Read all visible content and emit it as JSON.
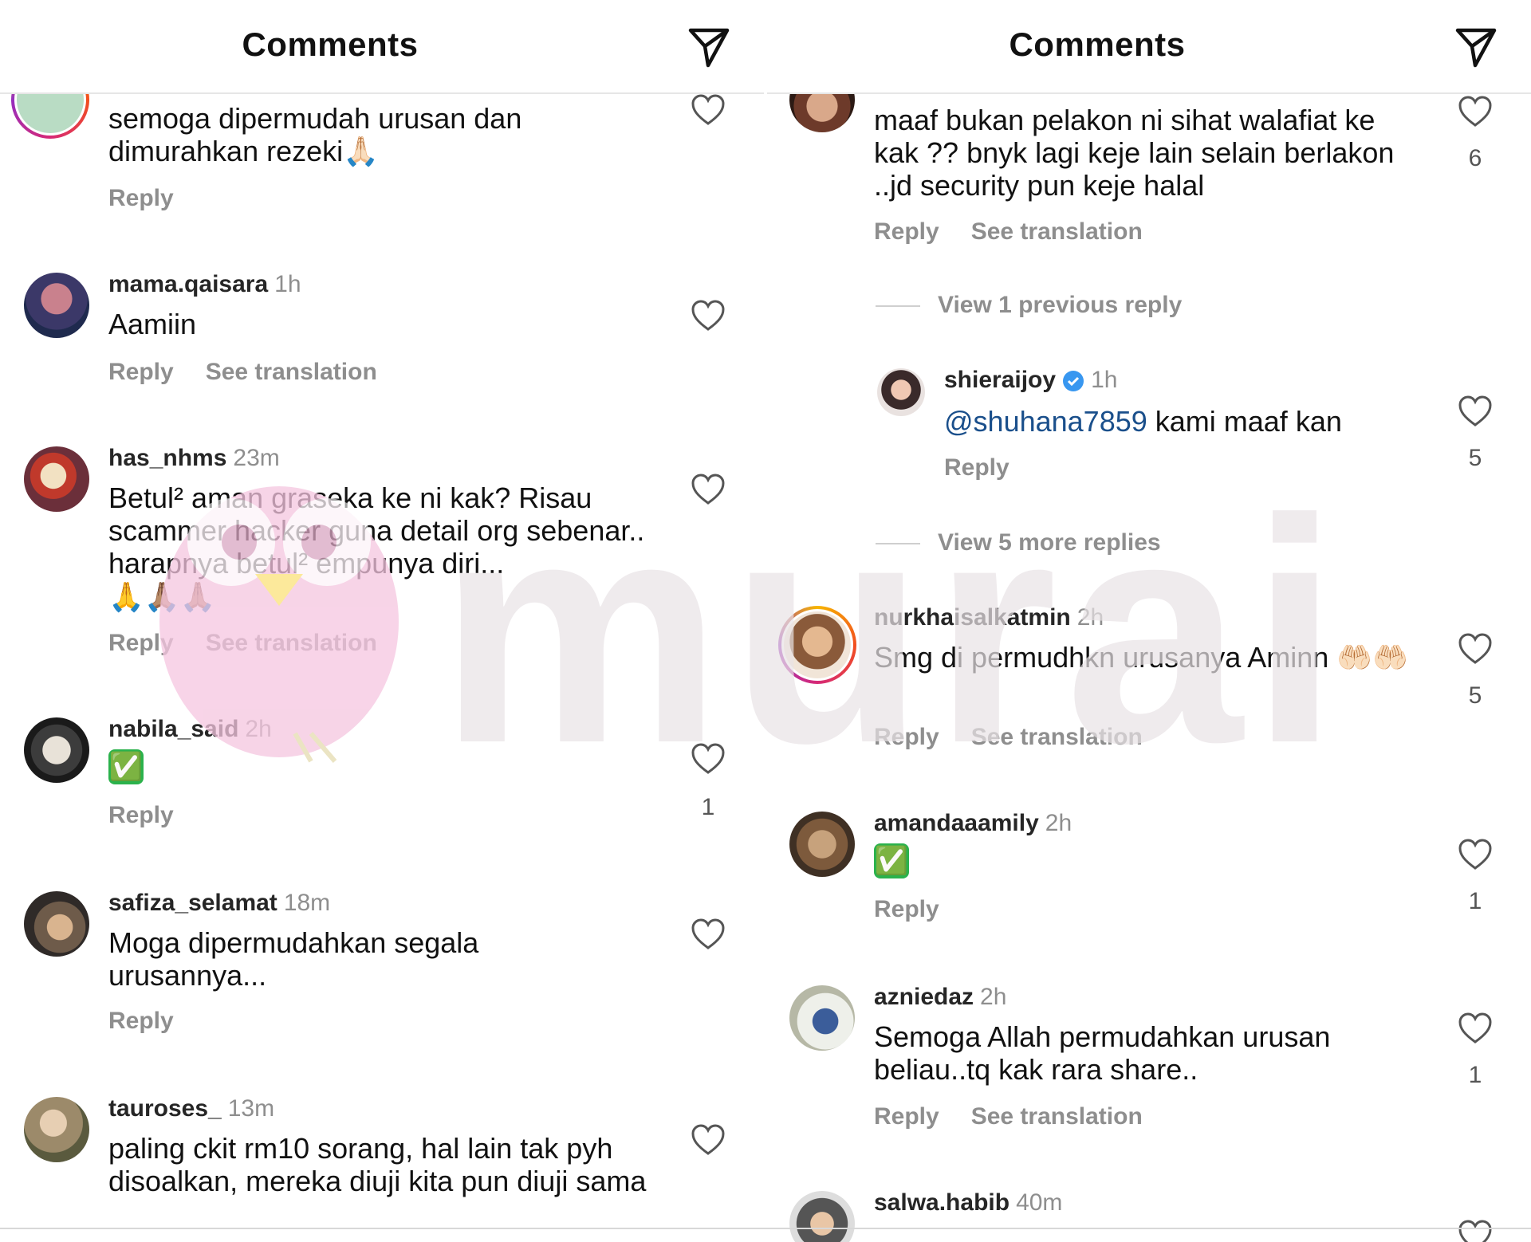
{
  "left": {
    "header": {
      "title": "Comments"
    },
    "comments": [
      {
        "text": "semoga dipermudah urusan dan dimurahkan rezeki🙏🏻",
        "reply": "Reply"
      },
      {
        "username": "mama.qaisara",
        "time": "1h",
        "text": "Aamiin",
        "reply": "Reply",
        "translate": "See translation"
      },
      {
        "username": "has_nhms",
        "time": "23m",
        "text": "Betul² aman graseka ke ni kak? Risau scammer hacker guna detail org sebenar.. harapnya betul² empunya diri...",
        "emoji": "🙏🙏🏽🙏🏽",
        "reply": "Reply",
        "translate": "See translation"
      },
      {
        "username": "nabila_said",
        "time": "2h",
        "text": "✅",
        "reply": "Reply",
        "likes": "1"
      },
      {
        "username": "safiza_selamat",
        "time": "18m",
        "text": "Moga dipermudahkan segala urusannya...",
        "reply": "Reply"
      },
      {
        "username": "tauroses_",
        "time": "13m",
        "text": "paling ckit rm10 sorang, hal lain tak pyh disoalkan, mereka diuji kita pun diuji sama"
      }
    ]
  },
  "right": {
    "header": {
      "title": "Comments"
    },
    "comments": [
      {
        "text": "maaf bukan pelakon ni sihat walafiat ke kak ?? bnyk lagi keje lain selain berlakon ..jd security pun keje halal",
        "reply": "Reply",
        "translate": "See translation",
        "likes": "6"
      },
      {
        "view_previous": "View 1 previous reply"
      },
      {
        "username": "shieraijoy",
        "time": "1h",
        "mention": "@shuhana7859",
        "text": " kami maaf kan",
        "reply": "Reply",
        "likes": "5"
      },
      {
        "view_more": "View 5 more replies"
      },
      {
        "username": "nurkhaisalkatmin",
        "time": "2h",
        "text": "Smg di permudhkn urusanya Aminn 🤲🏻🤲🏻",
        "reply": "Reply",
        "translate": "See translation",
        "likes": "5"
      },
      {
        "username": "amandaaamily",
        "time": "2h",
        "text": "✅",
        "reply": "Reply",
        "likes": "1"
      },
      {
        "username": "azniedaz",
        "time": "2h",
        "text": "Semoga Allah permudahkan urusan beliau..tq kak rara share..",
        "reply": "Reply",
        "translate": "See translation",
        "likes": "1"
      },
      {
        "username": "salwa.habib",
        "time": "40m"
      }
    ]
  },
  "watermark": {
    "text": "murai",
    "color": "#e9e3e6",
    "bird_color": "#f5c6e0",
    "beak_color": "#fbe27a"
  }
}
